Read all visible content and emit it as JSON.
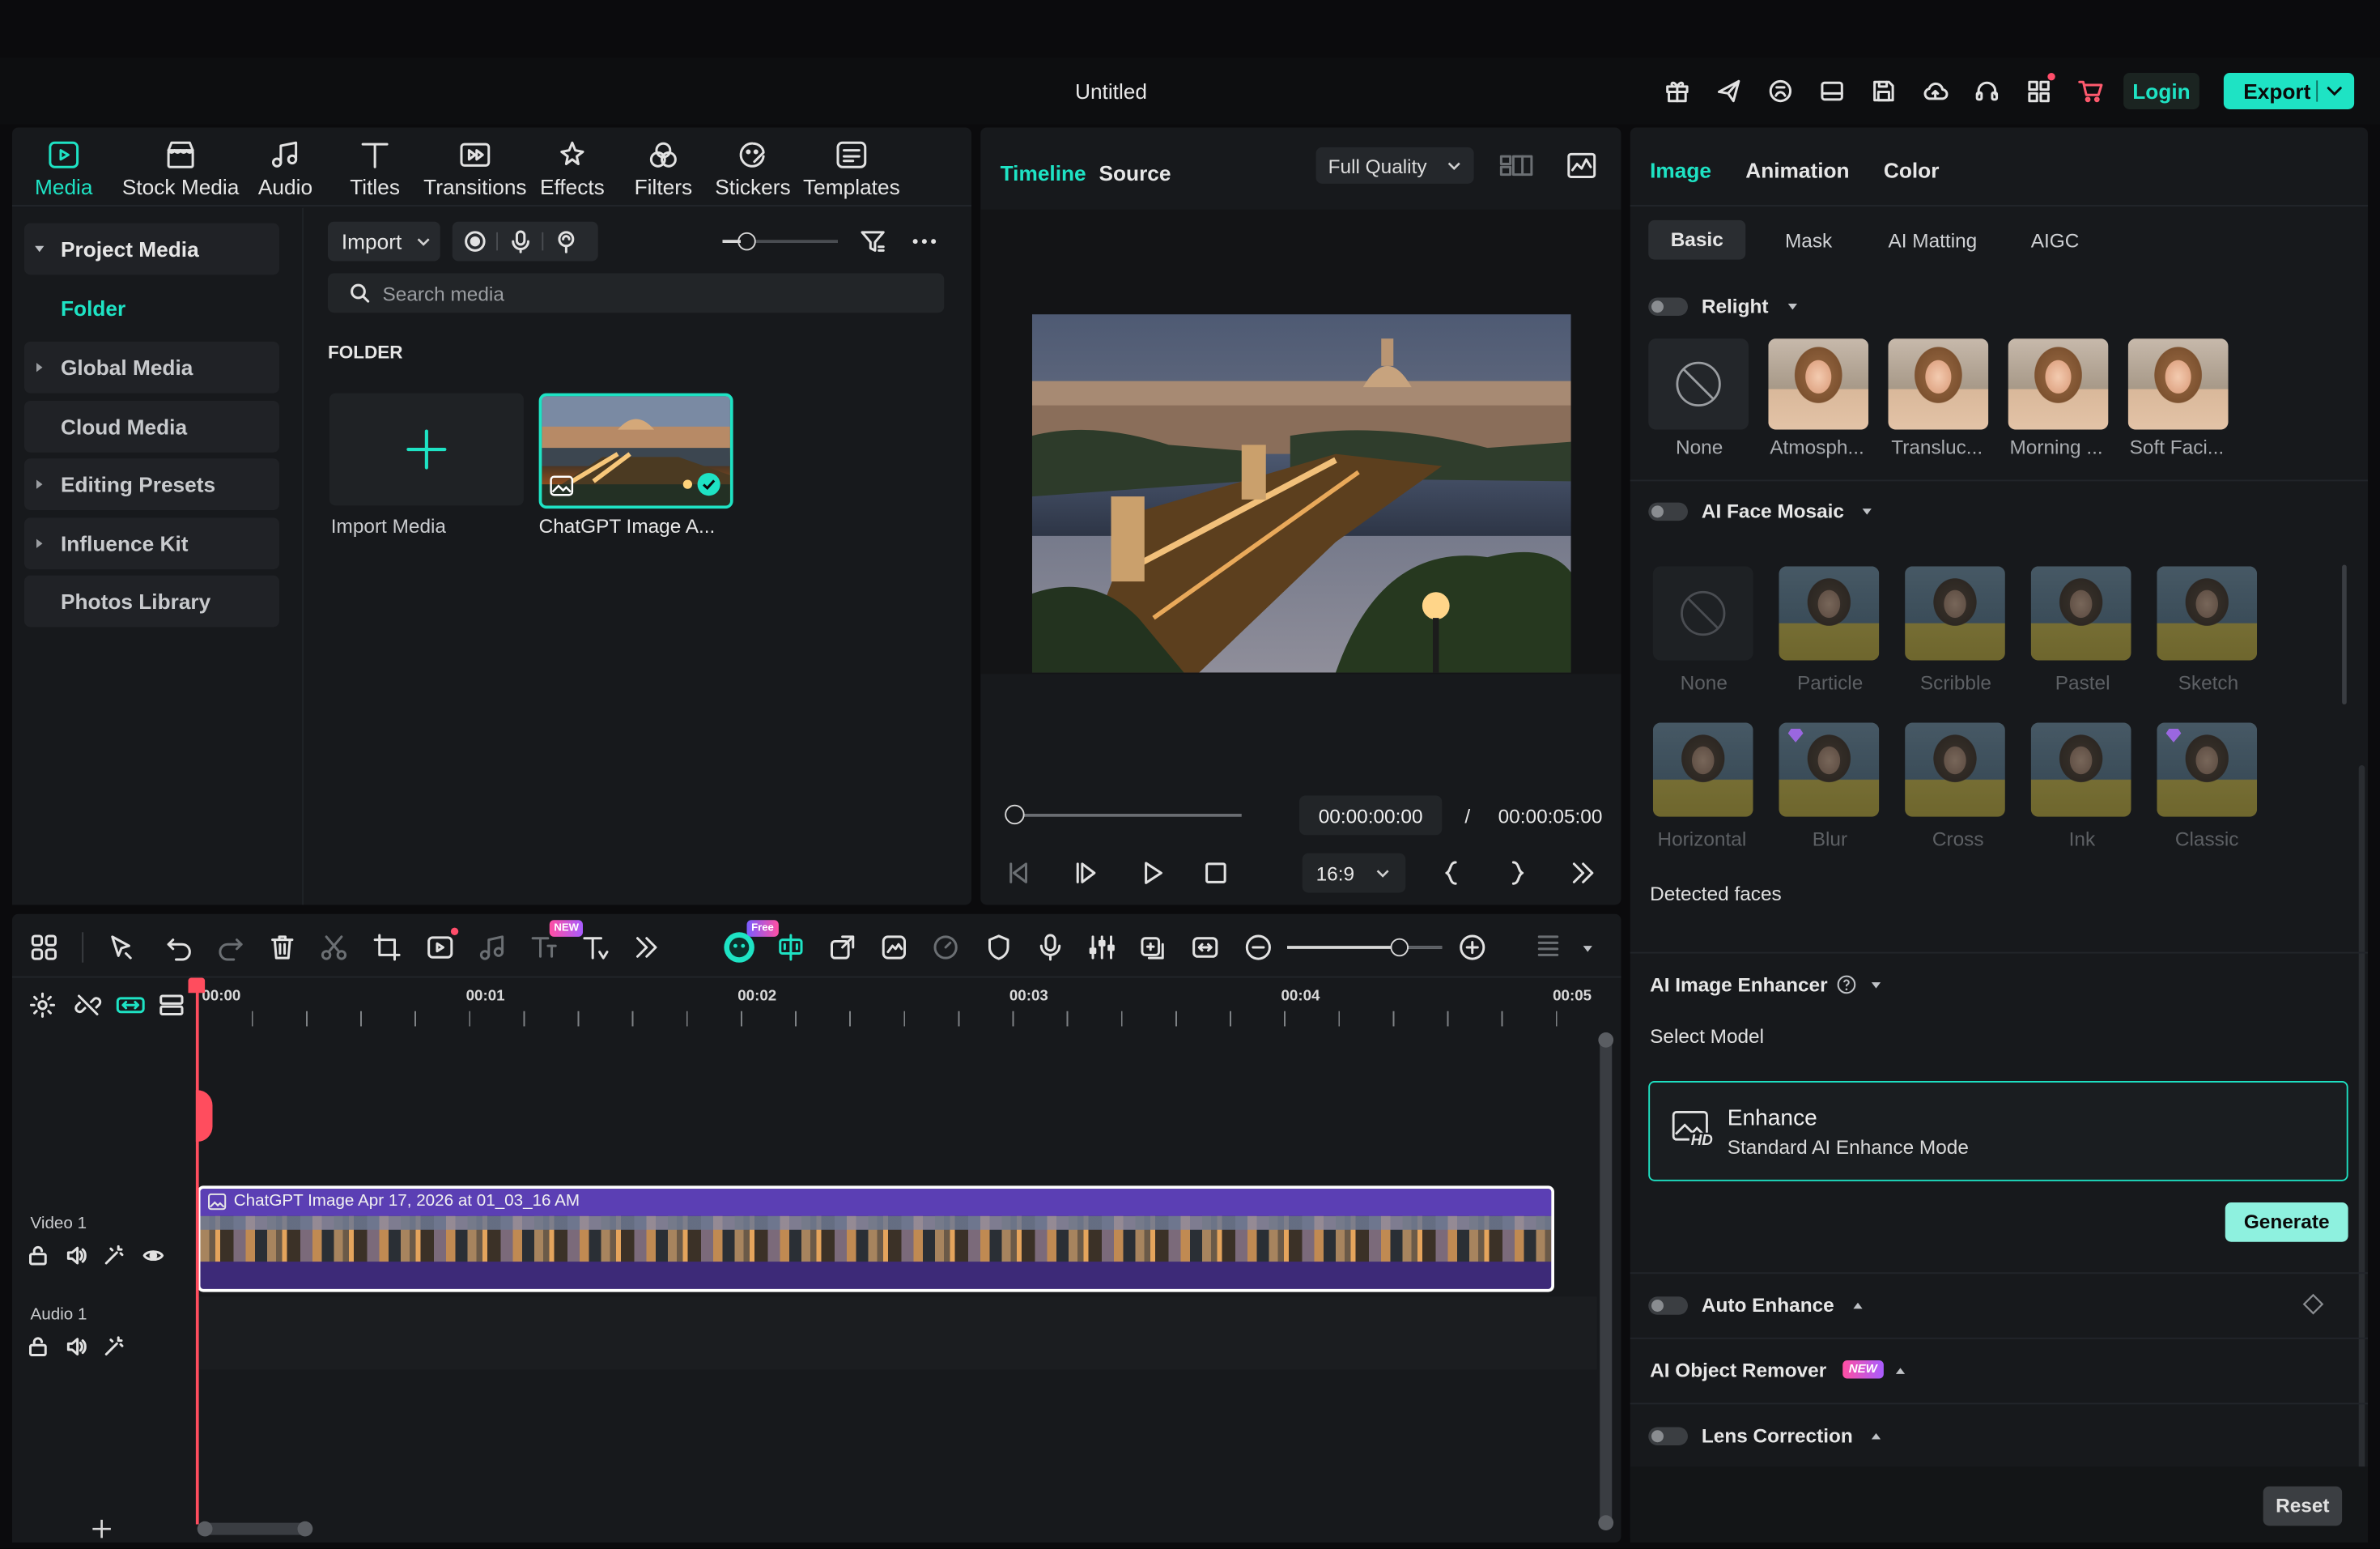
{
  "titlebar": {
    "title": "Untitled",
    "login": "Login",
    "export": "Export"
  },
  "media_tabs": [
    {
      "label": "Media",
      "icon": "media-icon",
      "active": true
    },
    {
      "label": "Stock Media",
      "icon": "stock-media-icon"
    },
    {
      "label": "Audio",
      "icon": "music-note-icon"
    },
    {
      "label": "Titles",
      "icon": "titles-icon"
    },
    {
      "label": "Transitions",
      "icon": "transitions-icon"
    },
    {
      "label": "Effects",
      "icon": "effects-icon"
    },
    {
      "label": "Filters",
      "icon": "filters-icon"
    },
    {
      "label": "Stickers",
      "icon": "stickers-icon"
    },
    {
      "label": "Templates",
      "icon": "templates-icon"
    }
  ],
  "sidebar": {
    "items": [
      {
        "label": "Project Media",
        "expandable": true,
        "expanded": true
      },
      {
        "label": "Folder",
        "child": true,
        "active": true
      },
      {
        "label": "Global Media",
        "expandable": true
      },
      {
        "label": "Cloud Media"
      },
      {
        "label": "Editing Presets",
        "expandable": true
      },
      {
        "label": "Influence Kit",
        "expandable": true
      },
      {
        "label": "Photos Library"
      }
    ]
  },
  "media": {
    "import_label": "Import",
    "search_placeholder": "Search media",
    "folder_heading": "FOLDER",
    "import_media_label": "Import Media",
    "clip_label": "ChatGPT Image A..."
  },
  "player": {
    "tab_timeline": "Timeline",
    "tab_source": "Source",
    "quality": "Full Quality",
    "current_time": "00:00:00:00",
    "separator": "/",
    "total_time": "00:00:05:00",
    "aspect": "16:9",
    "progress": 0
  },
  "timeline": {
    "ruler": [
      "00:00",
      "00:01",
      "00:02",
      "00:03",
      "00:04",
      "00:05"
    ],
    "new_badge": "NEW",
    "free_badge": "Free",
    "tracks": [
      {
        "name": "Video 1",
        "clip": "ChatGPT Image Apr 17, 2026 at 01_03_16 AM"
      },
      {
        "name": "Audio 1"
      }
    ]
  },
  "props": {
    "tabs": [
      "Image",
      "Animation",
      "Color"
    ],
    "subtabs": [
      "Basic",
      "Mask",
      "AI Matting",
      "AIGC"
    ],
    "relight": {
      "label": "Relight",
      "presets": [
        "None",
        "Atmosph...",
        "Transluc...",
        "Morning ...",
        "Soft Faci..."
      ]
    },
    "face_mosaic": {
      "label": "AI Face Mosaic",
      "row1": [
        "None",
        "Particle",
        "Scribble",
        "Pastel",
        "Sketch"
      ],
      "row2": [
        "Horizontal",
        "Blur",
        "Cross",
        "Ink",
        "Classic"
      ],
      "detected": "Detected faces"
    },
    "enhancer": {
      "label": "AI Image Enhancer",
      "select_model": "Select Model",
      "model_title": "Enhance",
      "model_desc": "Standard AI Enhance Mode",
      "hd_badge": "HD",
      "generate": "Generate"
    },
    "auto_enhance": "Auto Enhance",
    "object_remover": "AI Object Remover",
    "new_badge": "NEW",
    "lens_correction": "Lens Correction",
    "reset": "Reset"
  },
  "colors": {
    "accent": "#1ee3c4",
    "clip": "#5b3fb4",
    "playhead": "#ff4d5e"
  }
}
